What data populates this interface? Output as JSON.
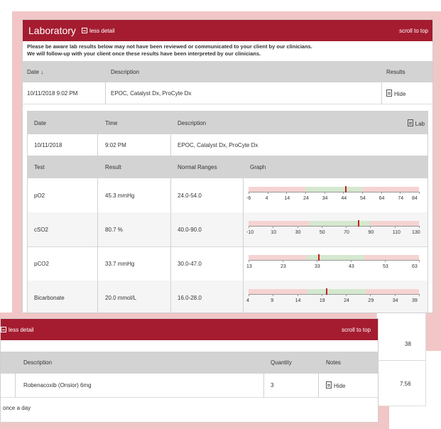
{
  "lab": {
    "title": "Laboratory",
    "less_detail": "less detail",
    "scroll_to_top": "scroll to top",
    "warning_line1": "Please be aware lab results below may not have been reviewed or communicated to your client by our clinicians.",
    "warning_line2": "We will follow-up with your client once these results have been interpreted by our clinicians.",
    "columns": {
      "date": "Date ↓",
      "description": "Description",
      "results": "Results"
    },
    "entry": {
      "date": "10/11/2018 9:02 PM",
      "description": "EPOC, Catalyst Dx, ProCyte Dx",
      "action": "Hide"
    },
    "detail": {
      "columns": {
        "date": "Date",
        "time": "Time",
        "description": "Description",
        "lab": "Lab"
      },
      "row": {
        "date": "10/11/2018",
        "time": "9:02 PM",
        "description": "EPOC, Catalyst Dx, ProCyte Dx"
      },
      "test_columns": {
        "test": "Test",
        "result": "Result",
        "range": "Normal Ranges",
        "graph": "Graph"
      },
      "tests": [
        {
          "name": "pO2",
          "result": "45.3 mmHg",
          "range": "24.0-54.0",
          "ticks": [
            "-6",
            "4",
            "14",
            "24",
            "34",
            "44",
            "54",
            "64",
            "74",
            "84"
          ],
          "min": -6,
          "max": 84,
          "low": 24,
          "high": 54,
          "value": 45.3
        },
        {
          "name": "cSO2",
          "result": "80.7 %",
          "range": "40.0-90.0",
          "ticks": [
            "-10",
            "10",
            "30",
            "50",
            "70",
            "90",
            "110",
            "130"
          ],
          "min": -10,
          "max": 130,
          "low": 40,
          "high": 90,
          "value": 80.7
        },
        {
          "name": "pCO2",
          "result": "33.7 mmHg",
          "range": "30.0-47.0",
          "ticks": [
            "13",
            "23",
            "33",
            "43",
            "53",
            "63"
          ],
          "min": 13,
          "max": 63,
          "low": 30,
          "high": 47,
          "value": 33.7
        },
        {
          "name": "Bicarbonate",
          "result": "20.0 mmol/L",
          "range": "16.0-28.0",
          "ticks": [
            "4",
            "9",
            "14",
            "19",
            "24",
            "29",
            "34",
            "39"
          ],
          "min": 4,
          "max": 39,
          "low": 16,
          "high": 28,
          "value": 20
        }
      ]
    }
  },
  "behind_values": {
    "first": "38",
    "second": "7.56"
  },
  "meds": {
    "less_detail": "less detail",
    "scroll_to_top": "scroll to top",
    "columns": {
      "description": "Description",
      "quantity": "Quantity",
      "notes": "Notes"
    },
    "item": {
      "description": "Robenacoxib (Onsior) 6mg",
      "quantity": "3",
      "notes": "Hide"
    },
    "instruction": "once a day"
  },
  "colors": {
    "header": "#a51c30",
    "frame": "#f2c6c6",
    "normal": "#d5e8cf",
    "abnormal": "#f6d3d3",
    "marker": "#c0201c"
  }
}
